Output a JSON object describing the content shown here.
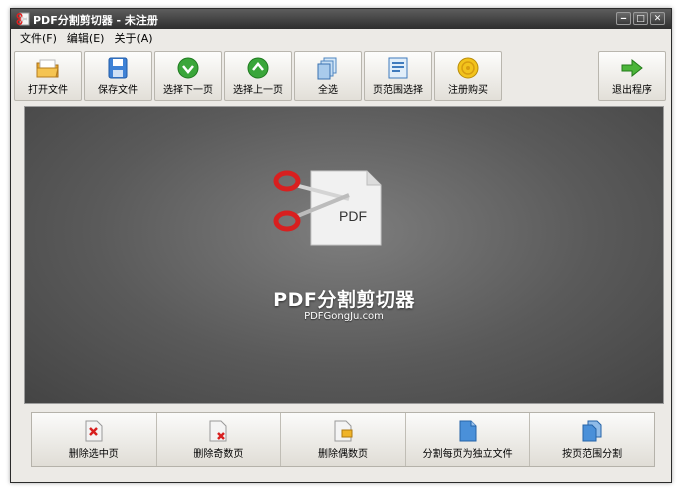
{
  "window": {
    "title": "PDF分割剪切器 - 未注册"
  },
  "window_controls": {
    "minimize": "‒",
    "maximize": "□",
    "close": "✕"
  },
  "menu": [
    "文件(F)",
    "编辑(E)",
    "关于(A)"
  ],
  "toolbar": [
    {
      "label": "打开文件",
      "icon": "open-folder-icon"
    },
    {
      "label": "保存文件",
      "icon": "save-disk-icon"
    },
    {
      "label": "选择下一页",
      "icon": "green-down-arrow-icon"
    },
    {
      "label": "选择上一页",
      "icon": "green-up-arrow-icon"
    },
    {
      "label": "全选",
      "icon": "select-all-pages-icon"
    },
    {
      "label": "页范围选择",
      "icon": "page-range-icon"
    },
    {
      "label": "注册购买",
      "icon": "gold-coin-icon"
    },
    {
      "label": "退出程序",
      "icon": "exit-arrow-icon"
    }
  ],
  "splash": {
    "title": "PDF分割剪切器",
    "subtitle": "PDFGongJu.com",
    "doc_label": "PDF"
  },
  "bottom_buttons": [
    {
      "label": "删除选中页",
      "icon": "delete-page-icon"
    },
    {
      "label": "删除奇数页",
      "icon": "delete-odd-pages-icon"
    },
    {
      "label": "删除偶数页",
      "icon": "delete-even-pages-icon"
    },
    {
      "label": "分割每页为独立文件",
      "icon": "split-each-page-icon"
    },
    {
      "label": "按页范围分割",
      "icon": "split-by-range-icon"
    }
  ],
  "colors": {
    "canvas": "#5a5a5a",
    "titlebar": "#3a3a3a",
    "accent_green": "#3aa63a",
    "scissor_red": "#d81f1f"
  }
}
